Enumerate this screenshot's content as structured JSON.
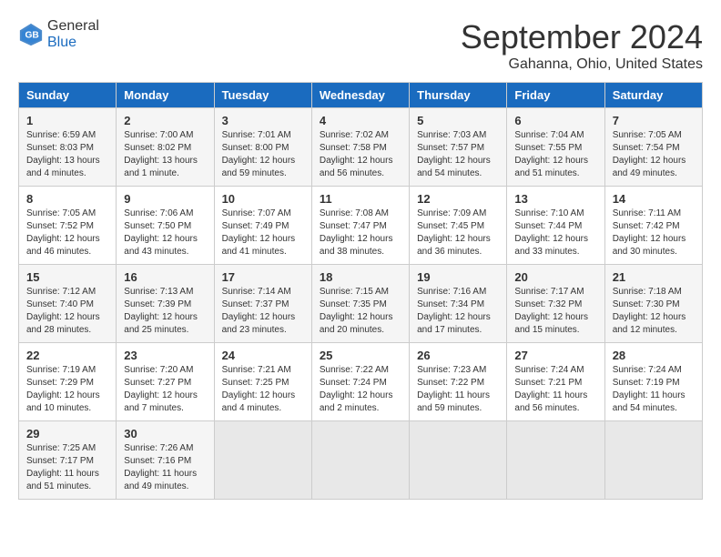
{
  "header": {
    "logo_line1": "General",
    "logo_line2": "Blue",
    "month_year": "September 2024",
    "location": "Gahanna, Ohio, United States"
  },
  "days_of_week": [
    "Sunday",
    "Monday",
    "Tuesday",
    "Wednesday",
    "Thursday",
    "Friday",
    "Saturday"
  ],
  "weeks": [
    [
      {
        "day": "1",
        "sunrise": "6:59 AM",
        "sunset": "8:03 PM",
        "daylight": "13 hours and 4 minutes"
      },
      {
        "day": "2",
        "sunrise": "7:00 AM",
        "sunset": "8:02 PM",
        "daylight": "13 hours and 1 minute"
      },
      {
        "day": "3",
        "sunrise": "7:01 AM",
        "sunset": "8:00 PM",
        "daylight": "12 hours and 59 minutes"
      },
      {
        "day": "4",
        "sunrise": "7:02 AM",
        "sunset": "7:58 PM",
        "daylight": "12 hours and 56 minutes"
      },
      {
        "day": "5",
        "sunrise": "7:03 AM",
        "sunset": "7:57 PM",
        "daylight": "12 hours and 54 minutes"
      },
      {
        "day": "6",
        "sunrise": "7:04 AM",
        "sunset": "7:55 PM",
        "daylight": "12 hours and 51 minutes"
      },
      {
        "day": "7",
        "sunrise": "7:05 AM",
        "sunset": "7:54 PM",
        "daylight": "12 hours and 49 minutes"
      }
    ],
    [
      {
        "day": "8",
        "sunrise": "7:05 AM",
        "sunset": "7:52 PM",
        "daylight": "12 hours and 46 minutes"
      },
      {
        "day": "9",
        "sunrise": "7:06 AM",
        "sunset": "7:50 PM",
        "daylight": "12 hours and 43 minutes"
      },
      {
        "day": "10",
        "sunrise": "7:07 AM",
        "sunset": "7:49 PM",
        "daylight": "12 hours and 41 minutes"
      },
      {
        "day": "11",
        "sunrise": "7:08 AM",
        "sunset": "7:47 PM",
        "daylight": "12 hours and 38 minutes"
      },
      {
        "day": "12",
        "sunrise": "7:09 AM",
        "sunset": "7:45 PM",
        "daylight": "12 hours and 36 minutes"
      },
      {
        "day": "13",
        "sunrise": "7:10 AM",
        "sunset": "7:44 PM",
        "daylight": "12 hours and 33 minutes"
      },
      {
        "day": "14",
        "sunrise": "7:11 AM",
        "sunset": "7:42 PM",
        "daylight": "12 hours and 30 minutes"
      }
    ],
    [
      {
        "day": "15",
        "sunrise": "7:12 AM",
        "sunset": "7:40 PM",
        "daylight": "12 hours and 28 minutes"
      },
      {
        "day": "16",
        "sunrise": "7:13 AM",
        "sunset": "7:39 PM",
        "daylight": "12 hours and 25 minutes"
      },
      {
        "day": "17",
        "sunrise": "7:14 AM",
        "sunset": "7:37 PM",
        "daylight": "12 hours and 23 minutes"
      },
      {
        "day": "18",
        "sunrise": "7:15 AM",
        "sunset": "7:35 PM",
        "daylight": "12 hours and 20 minutes"
      },
      {
        "day": "19",
        "sunrise": "7:16 AM",
        "sunset": "7:34 PM",
        "daylight": "12 hours and 17 minutes"
      },
      {
        "day": "20",
        "sunrise": "7:17 AM",
        "sunset": "7:32 PM",
        "daylight": "12 hours and 15 minutes"
      },
      {
        "day": "21",
        "sunrise": "7:18 AM",
        "sunset": "7:30 PM",
        "daylight": "12 hours and 12 minutes"
      }
    ],
    [
      {
        "day": "22",
        "sunrise": "7:19 AM",
        "sunset": "7:29 PM",
        "daylight": "12 hours and 10 minutes"
      },
      {
        "day": "23",
        "sunrise": "7:20 AM",
        "sunset": "7:27 PM",
        "daylight": "12 hours and 7 minutes"
      },
      {
        "day": "24",
        "sunrise": "7:21 AM",
        "sunset": "7:25 PM",
        "daylight": "12 hours and 4 minutes"
      },
      {
        "day": "25",
        "sunrise": "7:22 AM",
        "sunset": "7:24 PM",
        "daylight": "12 hours and 2 minutes"
      },
      {
        "day": "26",
        "sunrise": "7:23 AM",
        "sunset": "7:22 PM",
        "daylight": "11 hours and 59 minutes"
      },
      {
        "day": "27",
        "sunrise": "7:24 AM",
        "sunset": "7:21 PM",
        "daylight": "11 hours and 56 minutes"
      },
      {
        "day": "28",
        "sunrise": "7:24 AM",
        "sunset": "7:19 PM",
        "daylight": "11 hours and 54 minutes"
      }
    ],
    [
      {
        "day": "29",
        "sunrise": "7:25 AM",
        "sunset": "7:17 PM",
        "daylight": "11 hours and 51 minutes"
      },
      {
        "day": "30",
        "sunrise": "7:26 AM",
        "sunset": "7:16 PM",
        "daylight": "11 hours and 49 minutes"
      },
      null,
      null,
      null,
      null,
      null
    ]
  ],
  "labels": {
    "sunrise": "Sunrise:",
    "sunset": "Sunset:",
    "daylight": "Daylight:"
  }
}
